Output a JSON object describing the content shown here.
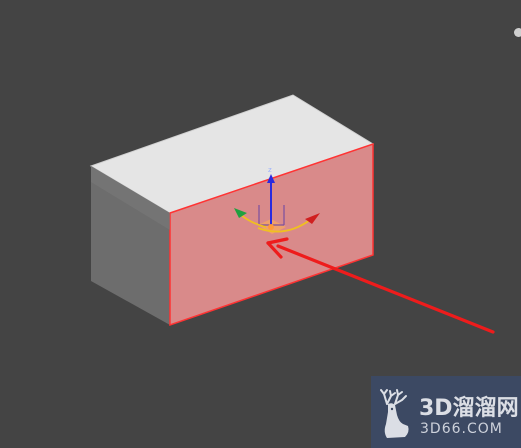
{
  "viewport": {
    "background_color": "#444444"
  },
  "scene": {
    "object": {
      "top_face_color": "#e5e5e5",
      "side_face_color": "#6d6d6d",
      "front_face_color": "#d98a8a",
      "edge_highlight_color": "#ff3333"
    },
    "gizmo": {
      "z_axis_label": "z",
      "z_axis_color": "#2a2adf",
      "x_axis_color": "#d02020",
      "y_axis_color": "#20a040",
      "plane_color": "#f0c020",
      "handle_color": "#ff9a3a"
    },
    "annotation_arrow_color": "#ee1c1c"
  },
  "watermark": {
    "brand_text": "3D溜溜网",
    "domain_text": "3D66.COM",
    "logo_icon": "deer-icon",
    "background_color": "#3c4a66"
  }
}
